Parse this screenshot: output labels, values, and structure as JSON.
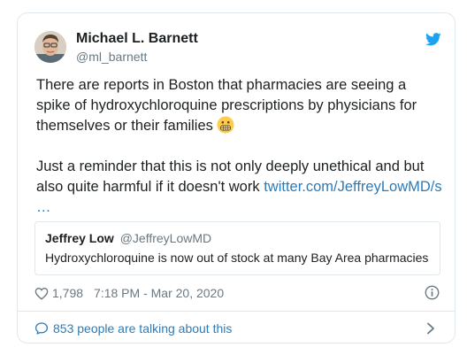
{
  "tweet": {
    "author": {
      "name": "Michael L. Barnett",
      "handle": "@ml_barnett",
      "avatar_icon": "avatar-photo"
    },
    "platform_icon": "twitter-bird-icon",
    "brand_color": "#1da1f2",
    "link_color": "#2b7bb9",
    "paragraph1": "There are reports in Boston that pharmacies are seeing a spike of hydroxychloroquine prescriptions by physicians for themselves or their families",
    "paragraph1_emoji": "grimacing-face-emoji",
    "paragraph2": "Just a reminder that this is not only deeply unethical and but also quite harmful if it doesn't work ",
    "link_text": "twitter.com/JeffreyLowMD/s",
    "link_ellipsis": "…",
    "quoted": {
      "name": "Jeffrey Low",
      "handle": "@JeffreyLowMD",
      "text": "Hydroxychloroquine is now out of stock at many Bay Area pharmacies"
    },
    "likes": "1,798",
    "timestamp": "7:18 PM - Mar 20, 2020",
    "like_icon": "heart-icon",
    "info_icon": "info-icon"
  },
  "footer": {
    "talking": "853 people are talking about this",
    "talking_icon": "speech-bubble-icon",
    "chevron_icon": "chevron-right-icon"
  }
}
